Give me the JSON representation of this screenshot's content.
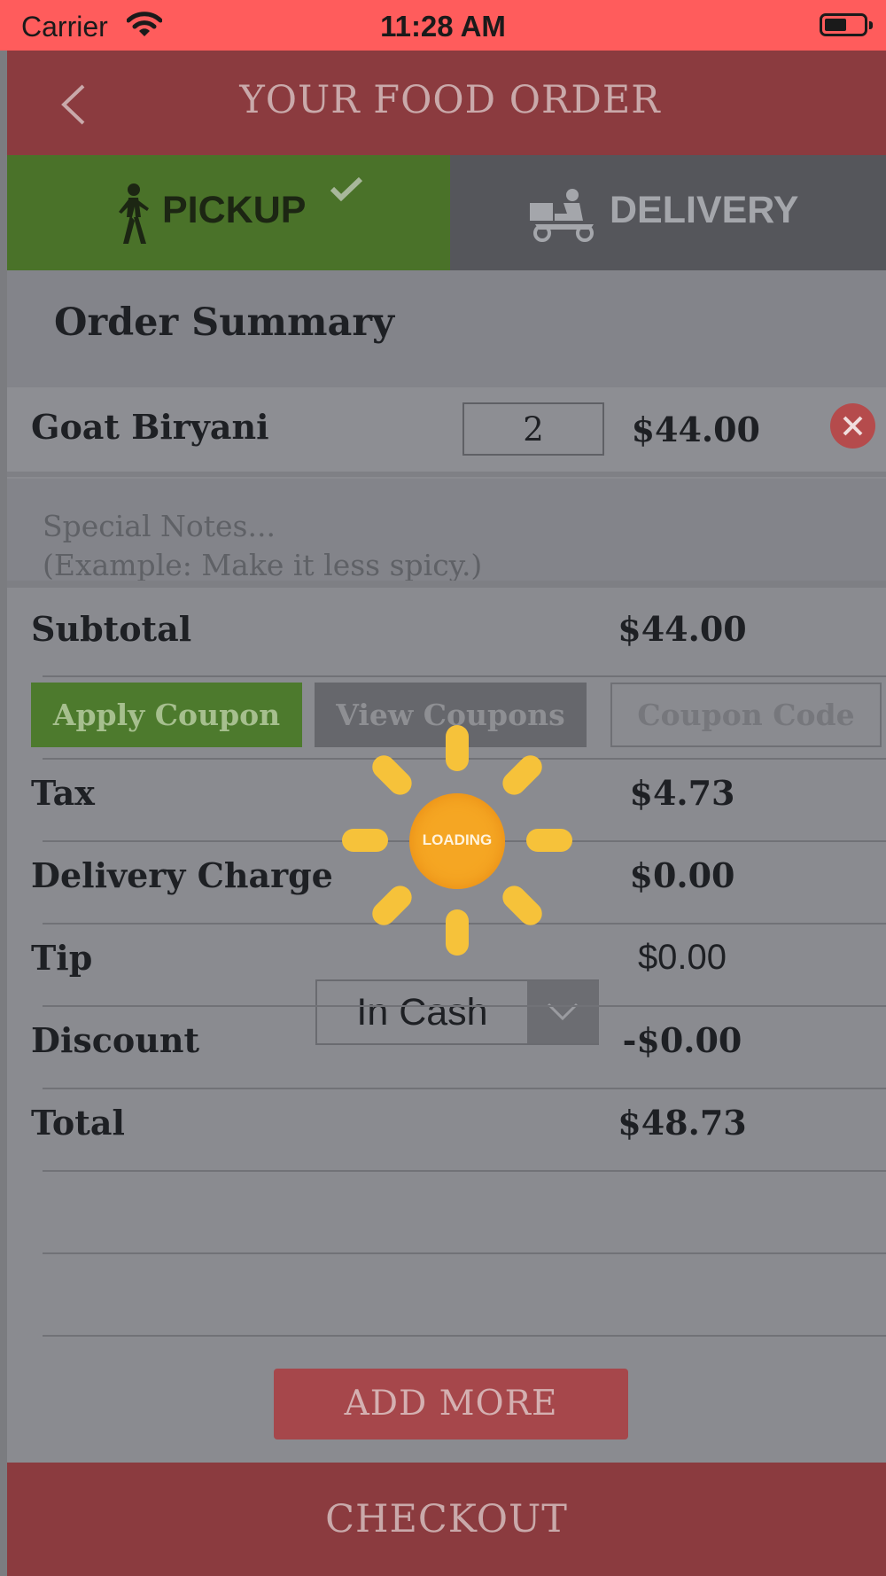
{
  "status_bar": {
    "carrier": "Carrier",
    "time": "11:28 AM",
    "battery_level": 0.5
  },
  "header": {
    "title": "YOUR FOOD ORDER",
    "back_icon": "chevron-left-icon"
  },
  "tabs": [
    {
      "label": "PICKUP",
      "icon": "walking-person-icon",
      "selected": true,
      "check_icon": "checkmark-icon"
    },
    {
      "label": "DELIVERY",
      "icon": "delivery-scooter-icon",
      "selected": false
    }
  ],
  "summary": {
    "title": "Order Summary",
    "items": [
      {
        "name": "Goat Biryani",
        "quantity": "2",
        "price": "$44.00"
      }
    ],
    "notes_placeholder_line1": "Special Notes...",
    "notes_placeholder_line2": "(Example: Make it less spicy.)"
  },
  "totals": {
    "subtotal_label": "Subtotal",
    "subtotal_value": "$44.00",
    "tax_label": "Tax",
    "tax_value": "$4.73",
    "delivery_label": "Delivery Charge",
    "delivery_value": "$0.00",
    "tip_label": "Tip",
    "tip_option": "In Cash",
    "tip_value": "$0.00",
    "discount_label": "Discount",
    "discount_value": "-$0.00",
    "total_label": "Total",
    "total_value": "$48.73"
  },
  "coupon": {
    "apply_label": "Apply Coupon",
    "view_label": "View Coupons",
    "code_placeholder": "Coupon Code"
  },
  "buttons": {
    "add_more": "ADD MORE",
    "checkout": "CHECKOUT"
  },
  "loading": {
    "label": "LOADING"
  },
  "colors": {
    "status_bar": "#ff5c5c",
    "header": "#8b3b3f",
    "pickup_tab": "#4a7229",
    "delivery_tab": "#55565b",
    "overlay": "#8a8b90",
    "loading": "#f5a623"
  }
}
